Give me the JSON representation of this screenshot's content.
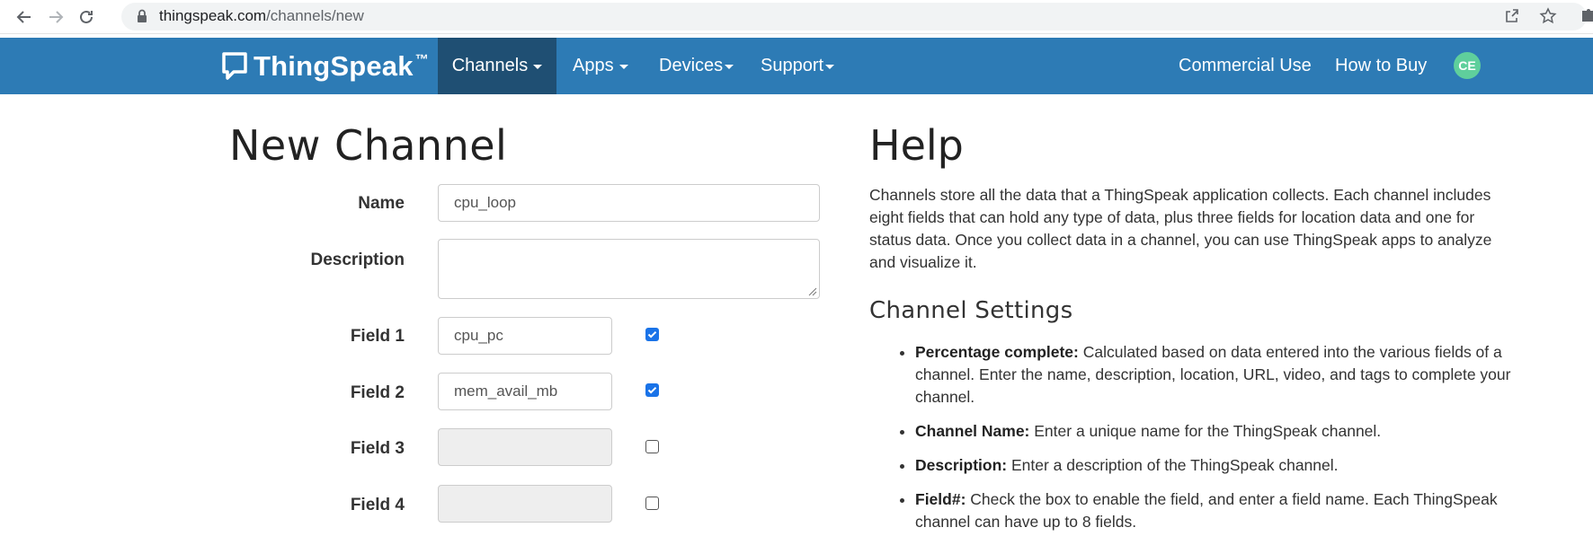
{
  "browser": {
    "url_domain": "thingspeak.com",
    "url_path": "/channels/new"
  },
  "navbar": {
    "brand": "ThingSpeak",
    "brand_tm": "™",
    "items": [
      {
        "label": "Channels"
      },
      {
        "label": "Apps"
      },
      {
        "label": "Devices"
      },
      {
        "label": "Support"
      }
    ],
    "commercial_use": "Commercial Use",
    "how_to_buy": "How to Buy",
    "avatar_initials": "CE"
  },
  "form": {
    "title": "New Channel",
    "name_label": "Name",
    "name_value": "cpu_loop",
    "description_label": "Description",
    "description_value": "",
    "fields": [
      {
        "label": "Field 1",
        "value": "cpu_pc",
        "checked": true
      },
      {
        "label": "Field 2",
        "value": "mem_avail_mb",
        "checked": true
      },
      {
        "label": "Field 3",
        "value": "",
        "checked": false
      },
      {
        "label": "Field 4",
        "value": "",
        "checked": false
      }
    ]
  },
  "help": {
    "title": "Help",
    "intro": "Channels store all the data that a ThingSpeak application collects. Each channel includes eight fields that can hold any type of data, plus three fields for location data and one for status data. Once you collect data in a channel, you can use ThingSpeak apps to analyze and visualize it.",
    "settings_title": "Channel Settings",
    "items": [
      {
        "term": "Percentage complete:",
        "text": " Calculated based on data entered into the various fields of a channel. Enter the name, description, location, URL, video, and tags to complete your channel."
      },
      {
        "term": "Channel Name:",
        "text": " Enter a unique name for the ThingSpeak channel."
      },
      {
        "term": "Description:",
        "text": " Enter a description of the ThingSpeak channel."
      },
      {
        "term": "Field#:",
        "text": " Check the box to enable the field, and enter a field name. Each ThingSpeak channel can have up to 8 fields."
      }
    ]
  },
  "colors": {
    "navbar": "#2d7bb5",
    "navbar_active": "#1f4f73",
    "checkbox_checked": "#1a73e8",
    "avatar": "#5fcf9c"
  }
}
